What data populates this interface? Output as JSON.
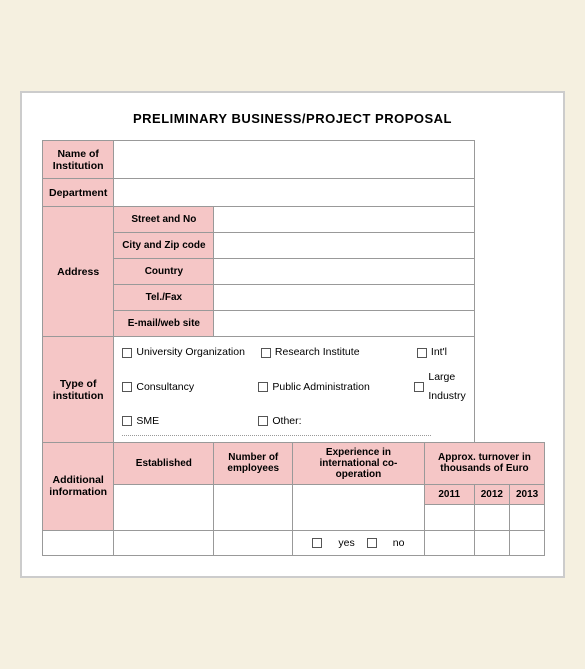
{
  "title": "PRELIMINARY BUSINESS/PROJECT PROPOSAL",
  "rows": {
    "name_of_institution": "Name of Institution",
    "department": "Department",
    "address": "Address",
    "street_and_no": "Street and No",
    "city_and_zip": "City and Zip code",
    "country": "Country",
    "tel_fax": "Tel./Fax",
    "email_web": "E-mail/web site",
    "type_of_institution": "Type of institution",
    "additional_information": "Additional information",
    "established": "Established",
    "number_of_employees": "Number of employees",
    "experience": "Experience in international co-operation",
    "approx_turnover": "Approx. turnover in thousands of Euro",
    "year_2011": "2011",
    "year_2012": "2012",
    "year_2013": "2013"
  },
  "checkboxes": {
    "university": "University Organization",
    "research_institute": "Research Institute",
    "intl": "Int'l",
    "consultancy": "Consultancy",
    "public_admin": "Public Administration",
    "large_industry": "Large Industry",
    "sme": "SME",
    "other": "Other:",
    "yes_label": "yes",
    "no_label": "no"
  }
}
